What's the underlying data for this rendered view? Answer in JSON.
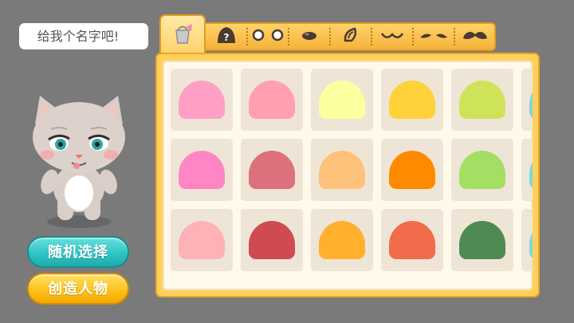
{
  "name_prompt": "给我个名字吧!",
  "buttons": {
    "random_label": "随机选择",
    "create_label": "创造人物"
  },
  "tabs": [
    {
      "icon": "paint-bucket-icon",
      "active": true
    },
    {
      "icon": "hair-icon",
      "active": false
    },
    {
      "icon": "eyes-icon",
      "active": false
    },
    {
      "icon": "nose-icon",
      "active": false
    },
    {
      "icon": "ear-icon",
      "active": false
    },
    {
      "icon": "mouth-icon",
      "active": false
    },
    {
      "icon": "eyebrows-icon",
      "active": false
    },
    {
      "icon": "mustache-icon",
      "active": false
    }
  ],
  "palette": [
    [
      "#ff9fc6",
      "#ff9fb0",
      "#feff9f",
      "#ffd13a",
      "#cfe35a"
    ],
    [
      "#ff86c4",
      "#dd707d",
      "#ffc27a",
      "#ff8a00",
      "#a4df63"
    ],
    [
      "#ffb1b8",
      "#cf4b51",
      "#ffb12e",
      "#f26b4b",
      "#4e8a52"
    ]
  ],
  "colors": {
    "background": "#7a7a7a",
    "panel": "#ffd15c",
    "panel_border": "#e8a526",
    "random_button": "#2fc5c5",
    "create_button": "#ffc21c",
    "partial_column_accent": "#7fd6d9"
  }
}
